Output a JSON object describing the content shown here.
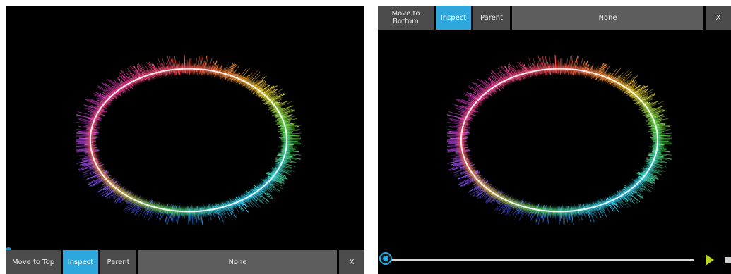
{
  "left": {
    "toolbar": {
      "move_label": "Move to Top",
      "inspect_label": "Inspect",
      "parent_label": "Parent",
      "selection_label": "None",
      "close_label": "X"
    }
  },
  "right": {
    "toolbar": {
      "move_label": "Move to Bottom",
      "inspect_label": "Inspect",
      "parent_label": "Parent",
      "selection_label": "None",
      "close_label": "X"
    },
    "timeline": {
      "progress": 0,
      "play_icon": "play-icon",
      "stop_icon": "stop-icon"
    }
  },
  "colors": {
    "accent": "#2ea7dd",
    "button": "#4b4b4b",
    "background": "#000000",
    "play": "#b7d51f"
  }
}
